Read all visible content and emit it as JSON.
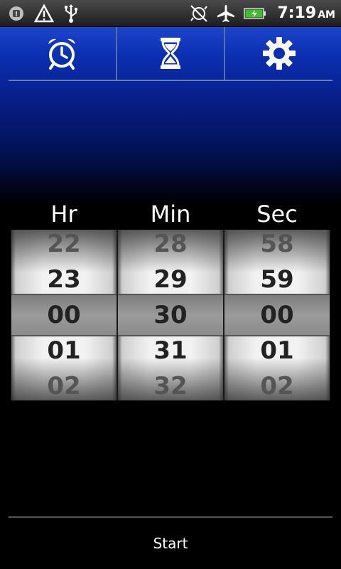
{
  "status_bar": {
    "time": "7:19",
    "ampm": "AM",
    "left_icons": [
      "app-notification-icon",
      "warning-icon",
      "usb-icon"
    ],
    "right_icons": [
      "sync-off-icon",
      "airplane-mode-icon",
      "battery-charging-icon"
    ]
  },
  "tabs": [
    {
      "name": "alarm",
      "icon": "alarm-clock-icon"
    },
    {
      "name": "timer",
      "icon": "hourglass-icon"
    },
    {
      "name": "settings",
      "icon": "gear-icon"
    }
  ],
  "picker": {
    "labels": {
      "hours": "Hr",
      "minutes": "Min",
      "seconds": "Sec"
    },
    "hours": [
      "22",
      "23",
      "00",
      "01",
      "02"
    ],
    "minutes": [
      "28",
      "29",
      "30",
      "31",
      "32"
    ],
    "seconds": [
      "58",
      "59",
      "00",
      "01",
      "02"
    ]
  },
  "footer": {
    "start_label": "Start"
  }
}
